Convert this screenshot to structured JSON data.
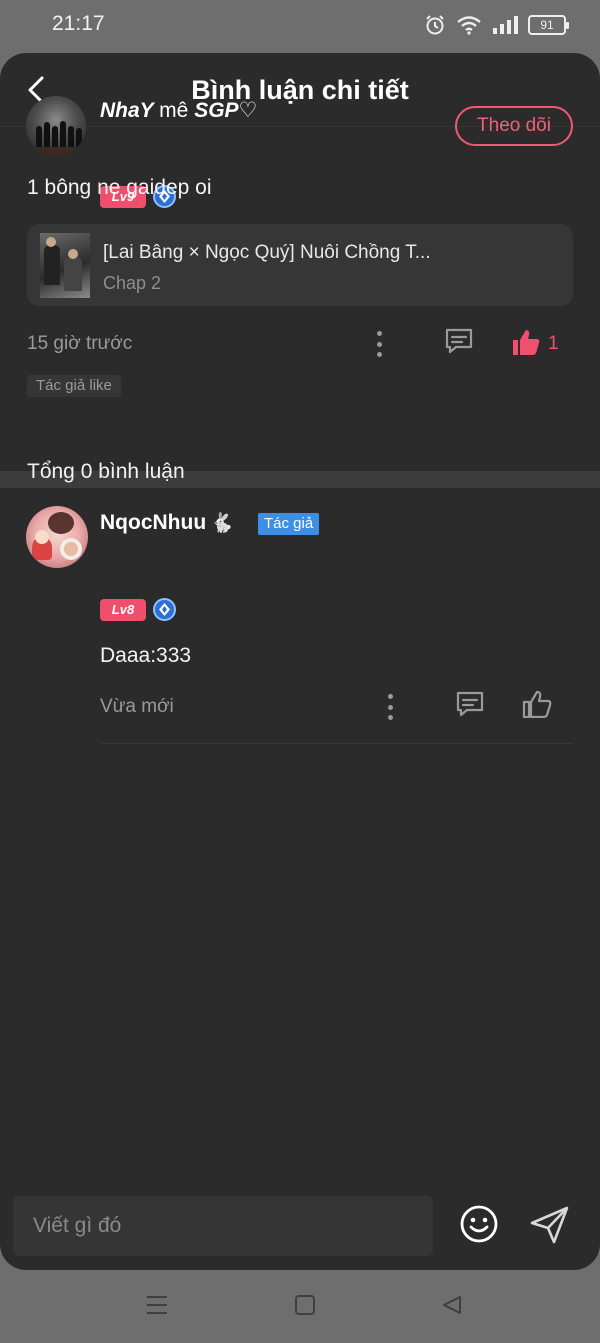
{
  "status_bar": {
    "time": "21:17",
    "battery": "91",
    "icons": [
      "alarm-icon",
      "wifi-icon",
      "signal-icon",
      "battery-icon"
    ]
  },
  "header": {
    "title": "Bình luận chi tiết",
    "back_icon": "chevron-left-icon"
  },
  "main_comment": {
    "username_bold": "NhaY",
    "username_rest": "mê",
    "username_tail": "SGP♡",
    "level": "Lv9",
    "follow_label": "Theo dõi",
    "text": "1 bông ne gaidep oi",
    "chapter": {
      "title": "[Lai Bâng × Ngọc Quý] Nuôi Chồng T...",
      "subtitle": "Chap 2"
    },
    "time": "15 giờ trước",
    "like_count": "1",
    "author_like_tag": "Tác giả like"
  },
  "replies": {
    "total_label": "Tổng 0 bình luận",
    "items": [
      {
        "username": "NqocNhuu",
        "emoji": "🐇",
        "author_tag": "Tác giả",
        "level": "Lv8",
        "text": "Daaa:333",
        "time": "Vừa mới"
      }
    ]
  },
  "input": {
    "placeholder": "Viết gì đó"
  },
  "colors": {
    "background": "#2b2b2b",
    "accent_pink": "#ef4f6d",
    "author_blue": "#3d8fe6",
    "muted_text": "#9a9a9a"
  }
}
